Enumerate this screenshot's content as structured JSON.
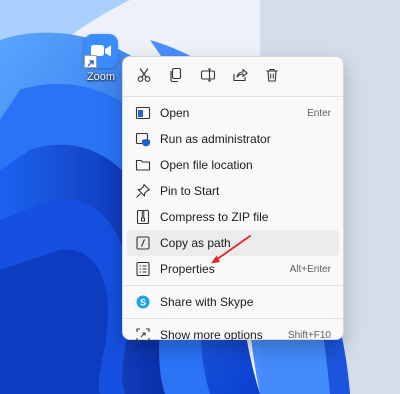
{
  "desktop": {
    "icon_label": "Zoom",
    "icon_name": "zoom-app-icon",
    "accent": "#3a8dff"
  },
  "context_menu": {
    "quick_actions": [
      {
        "name": "cut-icon"
      },
      {
        "name": "copy-icon"
      },
      {
        "name": "rename-icon"
      },
      {
        "name": "share-icon"
      },
      {
        "name": "delete-icon"
      }
    ],
    "items": [
      {
        "label": "Open",
        "shortcut": "Enter",
        "icon": "open-icon"
      },
      {
        "label": "Run as administrator",
        "shortcut": "",
        "icon": "shield-icon"
      },
      {
        "label": "Open file location",
        "shortcut": "",
        "icon": "folder-icon"
      },
      {
        "label": "Pin to Start",
        "shortcut": "",
        "icon": "pin-icon"
      },
      {
        "label": "Compress to ZIP file",
        "shortcut": "",
        "icon": "zip-icon"
      },
      {
        "label": "Copy as path",
        "shortcut": "",
        "icon": "copy-path-icon"
      },
      {
        "label": "Properties",
        "shortcut": "Alt+Enter",
        "icon": "properties-icon"
      },
      {
        "label": "Share with Skype",
        "shortcut": "",
        "icon": "skype-icon"
      },
      {
        "label": "Show more options",
        "shortcut": "Shift+F10",
        "icon": "more-options-icon"
      }
    ],
    "highlight_color": "#ececec",
    "annotation_color": "#e0262a"
  }
}
